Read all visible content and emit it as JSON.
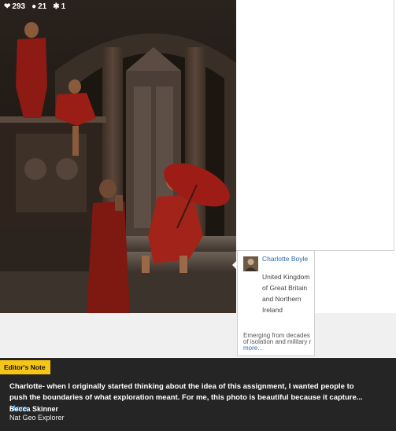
{
  "photo": {
    "likes": "293",
    "comments": "21",
    "favorites": "1",
    "icons": [
      "heart-icon",
      "comment-icon",
      "pin-icon"
    ]
  },
  "profile_card": {
    "name": "Charlotte Boyle",
    "country": "United Kingdom of Great Britain and Northern Ireland",
    "description": "Emerging from decades of isolation and military r",
    "more_label": "more..."
  },
  "editor_note": {
    "tag": "Editor's Note",
    "text": "Charlotte- when I originally started thinking about the idea of this assignment, I wanted people to push the boundaries of what exploration meant. For me, this photo is beautiful because it capture...",
    "more_label": "More",
    "author": "Becca Skinner",
    "role": "Nat Geo Explorer"
  },
  "colors": {
    "accent_link": "#2a6ab0",
    "tag_yellow": "#f5c518",
    "editor_bg": "#252525"
  }
}
